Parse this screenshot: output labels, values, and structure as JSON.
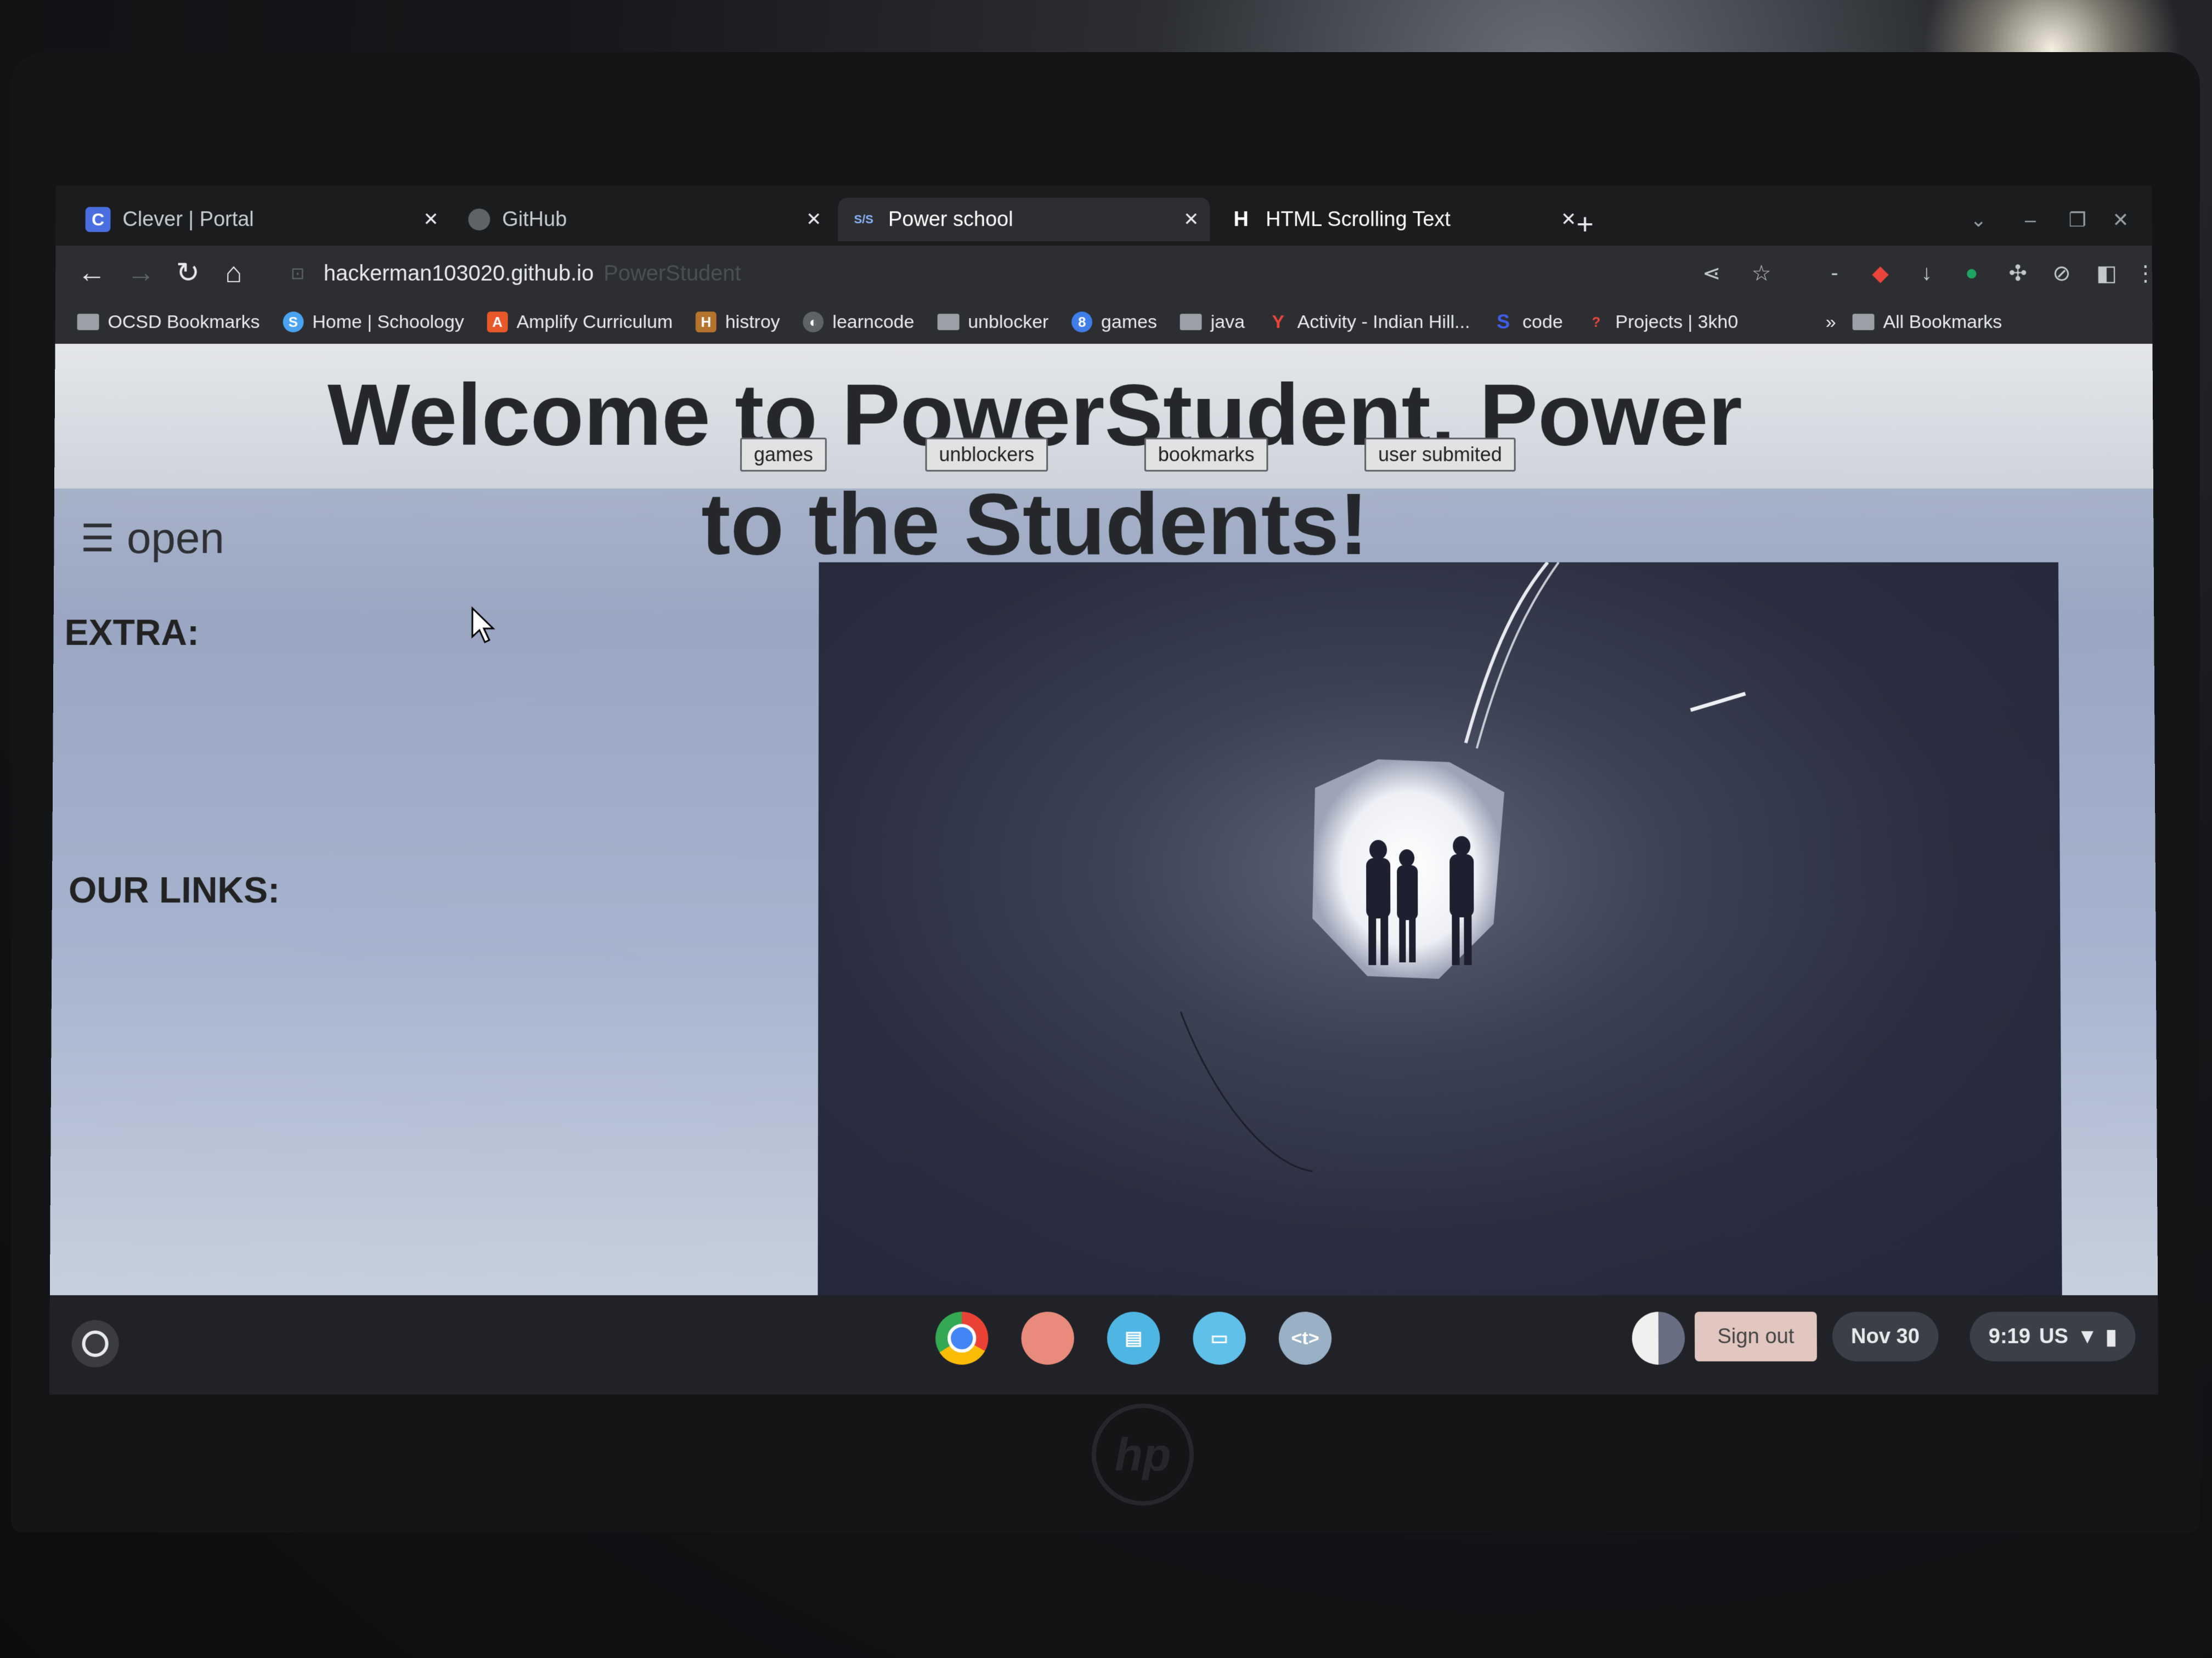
{
  "browser": {
    "tabs": [
      {
        "label": "Clever | Portal",
        "favicon": "C",
        "color": "#4a6ee0"
      },
      {
        "label": "GitHub",
        "favicon": "",
        "color": "#5f6368"
      },
      {
        "label": "Power school",
        "favicon": "S/S",
        "color": "#2d2e31"
      },
      {
        "label": "HTML Scrolling Text",
        "favicon": "H",
        "color": "#2d2e31"
      }
    ],
    "new_tab": "+",
    "address": {
      "host": "hackerman103020.github.io",
      "title": "PowerStudent"
    },
    "bookmarks": [
      {
        "label": "OCSD Bookmarks",
        "icon": "folder-icon"
      },
      {
        "label": "Home | Schoology",
        "icon": "schoology-icon",
        "glyph": "S",
        "color": "#4aa3f0"
      },
      {
        "label": "Amplify Curriculum",
        "icon": "amplify-icon",
        "glyph": "A",
        "color": "#e8582b"
      },
      {
        "label": "histroy",
        "icon": "history-icon",
        "glyph": "H",
        "color": "#b5742e"
      },
      {
        "label": "learncode",
        "icon": "globe-icon",
        "glyph": "◐",
        "color": "#5f6368"
      },
      {
        "label": "unblocker",
        "icon": "folder-icon"
      },
      {
        "label": "games",
        "icon": "games-icon",
        "glyph": "8",
        "color": "#3f7de8"
      },
      {
        "label": "java",
        "icon": "folder-icon"
      },
      {
        "label": "Activity - Indian Hill...",
        "icon": "activity-icon",
        "glyph": "Y",
        "color": "#e8453c"
      },
      {
        "label": "code",
        "icon": "code-icon",
        "glyph": "S",
        "color": "#3f5ee8"
      },
      {
        "label": "Projects | 3kh0",
        "icon": "projects-icon",
        "glyph": "?",
        "color": "#5f6368"
      }
    ],
    "more_bookmarks": "»",
    "all_bookmarks": "All Bookmarks"
  },
  "page": {
    "headline": "Welcome to PowerStudent, Power to the Students!",
    "nav": [
      "games",
      "unblockers",
      "bookmarks",
      "user submited"
    ],
    "opener": "open",
    "extra_label": "EXTRA:",
    "links_label": "OUR LINKS:"
  },
  "shelf": {
    "sign_out": "Sign out",
    "date": "Nov 30",
    "time": "9:19",
    "locale": "US",
    "apps": [
      {
        "name": "chrome-app-icon",
        "color": "#e8eaed"
      },
      {
        "name": "canvas-app-icon",
        "color": "#e98b7c"
      },
      {
        "name": "news-app-icon",
        "color": "#4fb6e3"
      },
      {
        "name": "files-app-icon",
        "color": "#5fc0ea"
      },
      {
        "name": "text-app-icon",
        "color": "#9ab0c4",
        "glyph": "<t>"
      }
    ]
  },
  "device": {
    "brand": "hp"
  }
}
